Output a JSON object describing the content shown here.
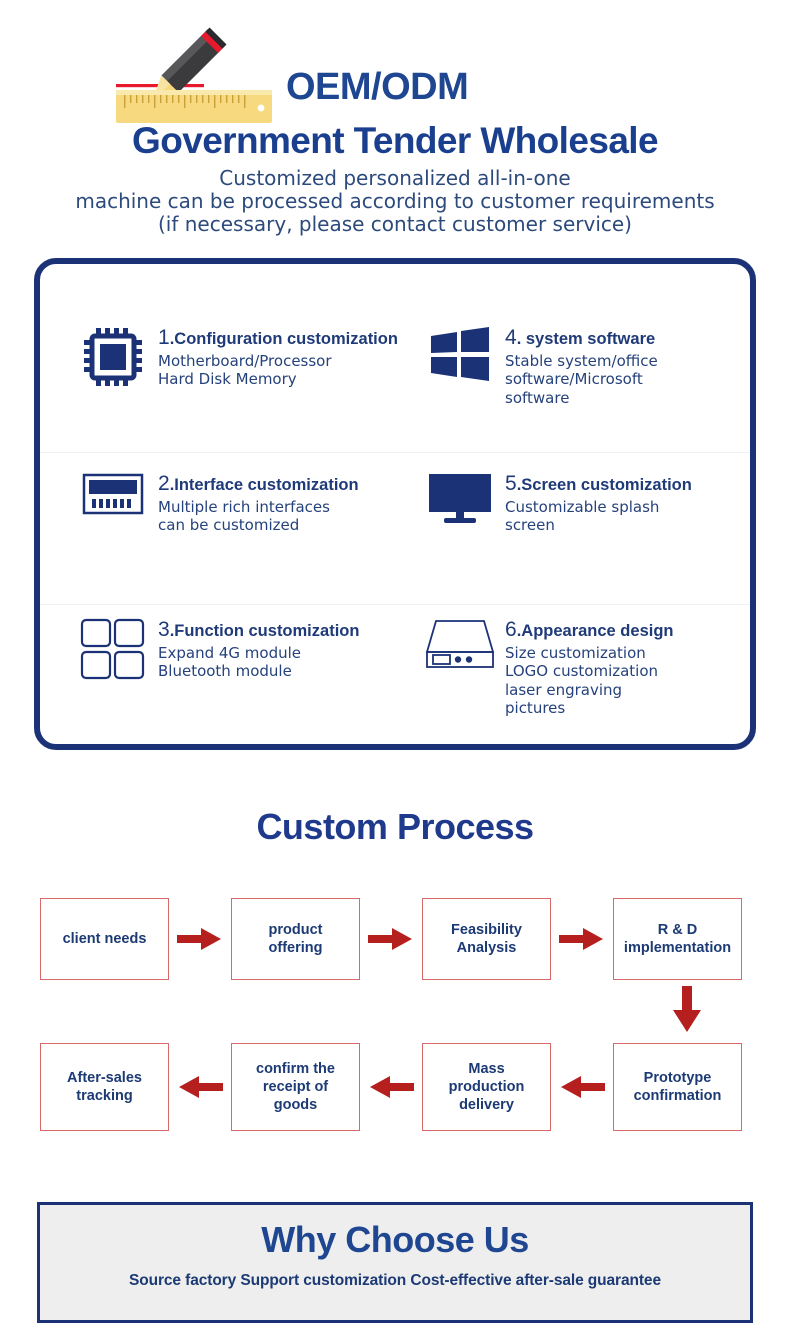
{
  "header": {
    "logo_icon": "pencil-ruler-icon",
    "oem_title": "OEM/ODM",
    "main_title": "Government Tender Wholesale",
    "subtitle_lines": [
      "Customized personalized all-in-one",
      "machine can be processed according to customer requirements",
      "(if necessary, please contact customer service)"
    ]
  },
  "features": [
    {
      "number": "1",
      "icon": "cpu-chip-icon",
      "title": ".Configuration customization",
      "desc_lines": [
        "Motherboard/Processor",
        "Hard Disk Memory"
      ]
    },
    {
      "number": "4",
      "icon": "windows-logo-icon",
      "title": ". system software",
      "desc_lines": [
        "Stable system/office",
        "software/Microsoft",
        "software"
      ]
    },
    {
      "number": "2",
      "icon": "interface-port-icon",
      "title": ".Interface customization",
      "desc_lines": [
        "Multiple rich interfaces",
        "can be customized"
      ]
    },
    {
      "number": "5",
      "icon": "monitor-icon",
      "title": ".Screen customization",
      "desc_lines": [
        "Customizable splash",
        "screen"
      ]
    },
    {
      "number": "3",
      "icon": "four-squares-module-icon",
      "title": ".Function customization",
      "desc_lines": [
        "Expand 4G module",
        "Bluetooth module"
      ]
    },
    {
      "number": "6",
      "icon": "device-chassis-icon",
      "title": ".Appearance design",
      "desc_lines": [
        "Size customization",
        "LOGO customization",
        "laser engraving",
        "pictures"
      ]
    }
  ],
  "process": {
    "title": "Custom Process",
    "top_row": [
      "client needs",
      "product\noffering",
      "Feasibility\nAnalysis",
      "R & D\nimplementation"
    ],
    "bottom_row": [
      "After-sales\ntracking",
      "confirm the\nreceipt of\ngoods",
      "Mass\nproduction\ndelivery",
      "Prototype\nconfirmation"
    ],
    "arrow_right_icon": "arrow-right-icon",
    "arrow_left_icon": "arrow-left-icon",
    "arrow_down_icon": "arrow-down-icon"
  },
  "why": {
    "title": "Why Choose Us",
    "subtitle": "Source factory Support customization Cost-effective after-sale guarantee"
  },
  "colors": {
    "brand_blue": "#1b3277",
    "title_blue": "#1f4690",
    "highlight": "#aec6ea",
    "arrow_red": "#b5201f",
    "box_border_red": "#d46a6a",
    "why_bg": "#eeeeee"
  }
}
